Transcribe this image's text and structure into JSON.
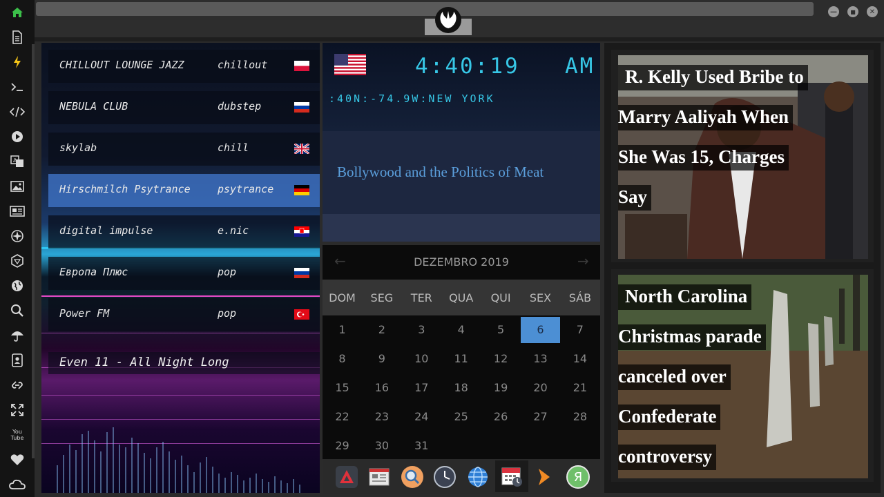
{
  "sidebar": {
    "icons": [
      "home-icon",
      "document-icon",
      "lightning-icon",
      "terminal-icon",
      "code-icon",
      "play-icon",
      "translate-icon",
      "image-icon",
      "news-icon",
      "rebel-alliance-icon",
      "hexagon-icon",
      "globe-icon",
      "search-icon",
      "umbrella-icon",
      "contacts-icon",
      "link-icon",
      "fullscreen-icon",
      "youtube-icon",
      "heart-icon",
      "cloud-icon"
    ],
    "youtube_label": "You Tube"
  },
  "window": {
    "minimize_label": "—",
    "maximize_label": "■",
    "close_label": "✕"
  },
  "radio": {
    "stations": [
      {
        "name": "CHILLOUT LOUNGE JAZZ",
        "genre": "chillout",
        "flag": "poland"
      },
      {
        "name": "NEBULA CLUB",
        "genre": "dubstep",
        "flag": "russia"
      },
      {
        "name": "skylab",
        "genre": "chill",
        "flag": "uk"
      },
      {
        "name": "Hirschmilch Psytrance",
        "genre": "psytrance",
        "flag": "germany"
      },
      {
        "name": "digital impulse",
        "genre": "e.nic",
        "flag": "croatia"
      },
      {
        "name": "Европа Плюс",
        "genre": "pop",
        "flag": "russia"
      },
      {
        "name": "Power FM",
        "genre": "pop",
        "flag": "turkey"
      }
    ],
    "now_playing": "Even 11 - All Night Long"
  },
  "clock": {
    "time": "4:40:19",
    "ampm": "AM",
    "location": ":40N:-74.9W:NEW YORK"
  },
  "headline": {
    "text": "Bollywood and the Politics of Meat",
    "color": "#5b9fdc"
  },
  "calendar": {
    "month": "DEZEMBRO 2019",
    "prev": "←",
    "next": "→",
    "weekdays": [
      "DOM",
      "SEG",
      "TER",
      "QUA",
      "QUI",
      "SEX",
      "SÁB"
    ],
    "weeks": [
      [
        "1",
        "2",
        "3",
        "4",
        "5",
        "6",
        "7"
      ],
      [
        "8",
        "9",
        "10",
        "11",
        "12",
        "13",
        "14"
      ],
      [
        "15",
        "16",
        "17",
        "18",
        "19",
        "20",
        "21"
      ],
      [
        "22",
        "23",
        "24",
        "25",
        "26",
        "27",
        "28"
      ],
      [
        "29",
        "30",
        "31",
        "",
        "",
        "",
        ""
      ]
    ],
    "today": "6",
    "accent": "#4c8fd4"
  },
  "dock": {
    "items": [
      "vivaldi-icon",
      "calendar-news-icon",
      "search-icon",
      "clock-icon",
      "globe-icon",
      "calendar-icon",
      "arrow-icon",
      "yandex-icon"
    ],
    "yandex_label": "Я"
  },
  "news": {
    "card1_lines": [
      "R. Kelly Used Bribe to",
      "Marry Aaliyah When",
      "She Was 15, Charges",
      "Say"
    ],
    "card2_lines": [
      "North Carolina",
      "Christmas parade",
      "canceled over",
      "Confederate",
      "controversy"
    ]
  }
}
